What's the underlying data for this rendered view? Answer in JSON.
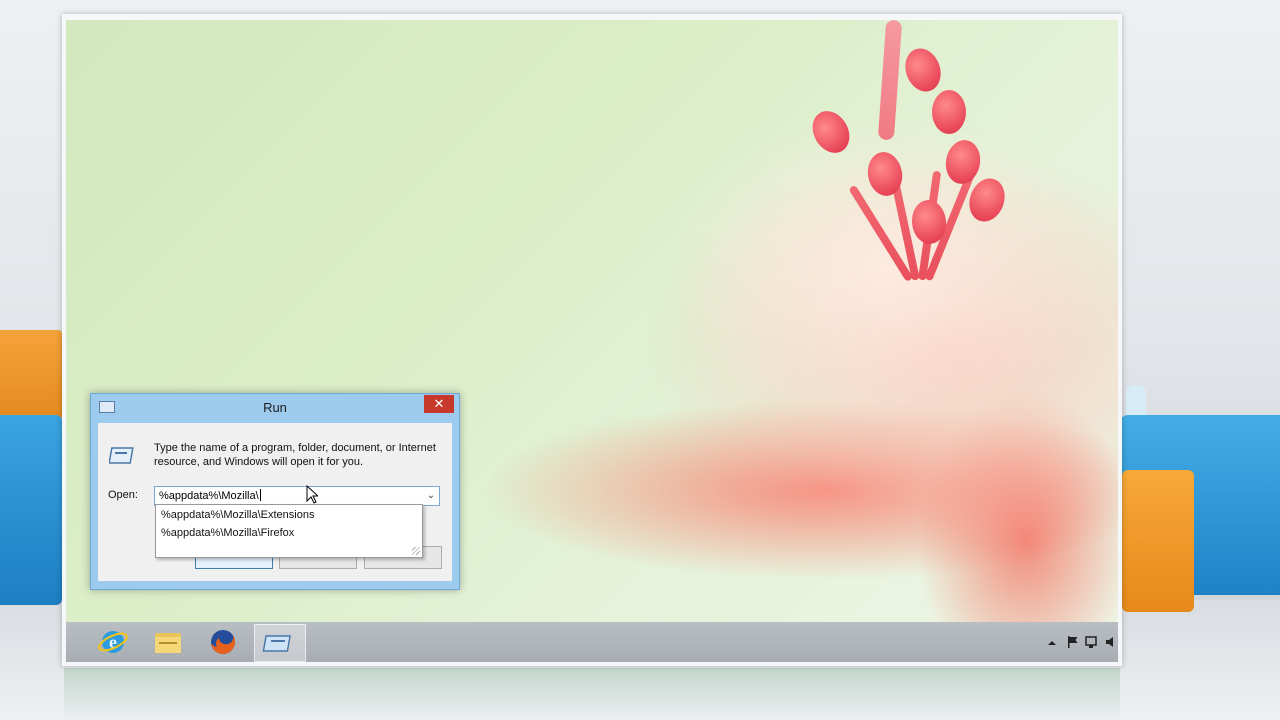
{
  "run_dialog": {
    "title": "Run",
    "close_glyph": "✕",
    "description": "Type the name of a program, folder, document, or Internet resource, and Windows will open it for you.",
    "open_label": "Open:",
    "input_value": "%appdata%\\Mozilla\\",
    "dropdown_glyph": "⌄",
    "buttons": {
      "ok": "",
      "cancel": "",
      "browse": ""
    }
  },
  "autocomplete": {
    "items": [
      "%appdata%\\Mozilla\\Extensions",
      "%appdata%\\Mozilla\\Firefox"
    ]
  },
  "taskbar": {
    "pinned": [
      {
        "name": "internet-explorer",
        "icon": "ie-icon"
      },
      {
        "name": "file-explorer",
        "icon": "folder-icon"
      },
      {
        "name": "firefox",
        "icon": "firefox-icon"
      },
      {
        "name": "run",
        "icon": "run-icon",
        "active": true
      }
    ],
    "tray_icons": [
      "show-hidden-icons-arrow",
      "action-center-flag-icon",
      "network-icon",
      "volume-icon"
    ]
  },
  "colors": {
    "titlebar": "#9ccbee",
    "close_button": "#c7392b",
    "taskbar": "#b0b5ba"
  }
}
